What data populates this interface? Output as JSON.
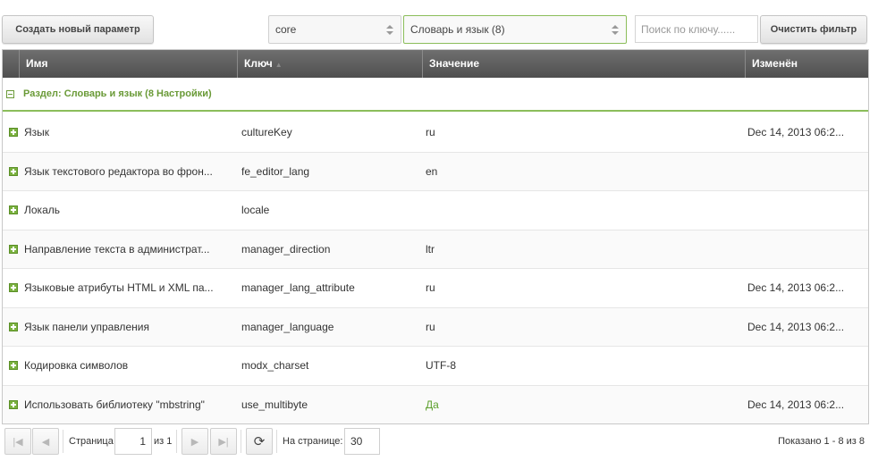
{
  "toolbar": {
    "create_label": "Создать новый параметр",
    "namespace_value": "core",
    "area_value": "Словарь и язык (8)",
    "search_placeholder": "Поиск по ключу......",
    "clear_label": "Очистить фильтр"
  },
  "grid": {
    "columns": {
      "name": "Имя",
      "key": "Ключ",
      "value": "Значение",
      "edited": "Изменён"
    },
    "group_label": "Раздел: Словарь и язык (8 Настройки)",
    "rows": [
      {
        "name": "Язык",
        "key": "cultureKey",
        "value": "ru",
        "edited": "Dec 14, 2013 06:2..."
      },
      {
        "name": "Язык текстового редактора во фрон...",
        "key": "fe_editor_lang",
        "value": "en",
        "edited": ""
      },
      {
        "name": "Локаль",
        "key": "locale",
        "value": "",
        "edited": ""
      },
      {
        "name": "Направление текста в администрат...",
        "key": "manager_direction",
        "value": "ltr",
        "edited": ""
      },
      {
        "name": "Языковые атрибуты HTML и XML па...",
        "key": "manager_lang_attribute",
        "value": "ru",
        "edited": "Dec 14, 2013 06:2..."
      },
      {
        "name": "Язык панели управления",
        "key": "manager_language",
        "value": "ru",
        "edited": "Dec 14, 2013 06:2..."
      },
      {
        "name": "Кодировка символов",
        "key": "modx_charset",
        "value": "UTF-8",
        "edited": ""
      },
      {
        "name": "Использовать библиотеку \"mbstring\"",
        "key": "use_multibyte",
        "value": "Да",
        "edited": "Dec 14, 2013 06:2..."
      }
    ]
  },
  "pager": {
    "page_label": "Страница",
    "page_value": "1",
    "of_label": "из 1",
    "per_page_label": "На странице:",
    "per_page_value": "30",
    "shown_label": "Показано 1 - 8 из 8"
  },
  "colors": {
    "accent": "#8bbd5a",
    "group_text": "#6a9a37",
    "header_bg": "#5a5a5a",
    "yes_value": "#5ea02e"
  }
}
